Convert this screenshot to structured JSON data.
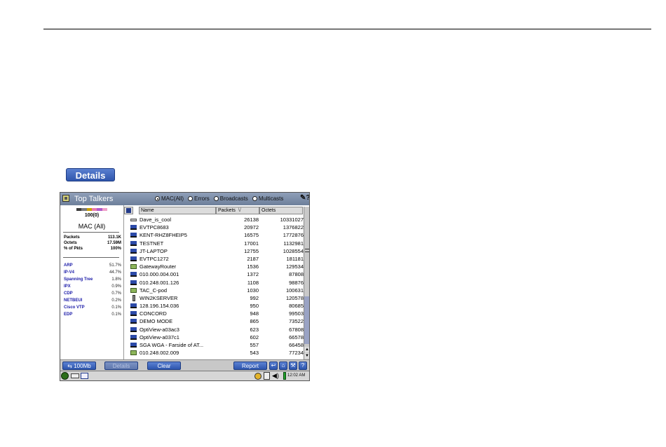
{
  "callout": {
    "details_label": "Details"
  },
  "window": {
    "title": "Top Talkers",
    "radio_options": [
      {
        "label": "MAC(All)",
        "selected": true
      },
      {
        "label": "Errors",
        "selected": false
      },
      {
        "label": "Broadcasts",
        "selected": false
      },
      {
        "label": "Multicasts",
        "selected": false
      }
    ],
    "help_icon": "help-question-icon"
  },
  "summary": {
    "counter": "100(0)",
    "mac_label": "MAC (All)",
    "stats": [
      {
        "label": "Packets",
        "value": "113.1K"
      },
      {
        "label": "Octets",
        "value": "17.59M"
      },
      {
        "label": "% of Pkts",
        "value": "100%"
      }
    ],
    "protocols": [
      {
        "name": "ARP",
        "value": "51.7%"
      },
      {
        "name": "IP-V4",
        "value": "44.7%"
      },
      {
        "name": "Spanning Tree",
        "value": "1.8%"
      },
      {
        "name": "IPX",
        "value": "0.9%"
      },
      {
        "name": "CDP",
        "value": "0.7%"
      },
      {
        "name": "NETBEUI",
        "value": "0.2%"
      },
      {
        "name": "Cisco VTP",
        "value": "0.1%"
      },
      {
        "name": "EDP",
        "value": "0.1%"
      }
    ],
    "strip_colors": [
      "#3a3a3a",
      "#7a7a7a",
      "#c9a000",
      "#e87ab0",
      "#b05ac8",
      "#f0a0c8"
    ]
  },
  "table": {
    "columns": {
      "name": "Name",
      "packets": "Packets",
      "octets": "Octets",
      "sort_mark": "\\/"
    },
    "rows": [
      {
        "icon": "host",
        "name": "Dave_is_cool",
        "packets": "26138",
        "octets": "10331027"
      },
      {
        "icon": "pc",
        "name": "EVTPC8683",
        "packets": "20972",
        "octets": "1376822"
      },
      {
        "icon": "pc",
        "name": "KENT-RHZ8FHEIP5",
        "packets": "16575",
        "octets": "1772876"
      },
      {
        "icon": "pc",
        "name": "TESTNET",
        "packets": "17001",
        "octets": "1132981"
      },
      {
        "icon": "pc",
        "name": "JT-LAPTOP",
        "packets": "12755",
        "octets": "1028554"
      },
      {
        "icon": "pc",
        "name": "EVTPC1272",
        "packets": "2187",
        "octets": "181181"
      },
      {
        "icon": "router",
        "name": "GatewayRouter",
        "packets": "1536",
        "octets": "129534"
      },
      {
        "icon": "pc",
        "name": "010.000.004.001",
        "packets": "1372",
        "octets": "87808"
      },
      {
        "icon": "pc",
        "name": "010.248.001.126",
        "packets": "1108",
        "octets": "98876"
      },
      {
        "icon": "router",
        "name": "TAC_C-pod",
        "packets": "1030",
        "octets": "100631"
      },
      {
        "icon": "server",
        "name": "WIN2KSERVER",
        "packets": "992",
        "octets": "120578"
      },
      {
        "icon": "pc",
        "name": "128.196.154.036",
        "packets": "950",
        "octets": "80685"
      },
      {
        "icon": "pc",
        "name": "CONCORD",
        "packets": "948",
        "octets": "99503"
      },
      {
        "icon": "pc",
        "name": "DEMO MODE",
        "packets": "865",
        "octets": "73522"
      },
      {
        "icon": "pc",
        "name": "OptiView-a03ac3",
        "packets": "623",
        "octets": "67808"
      },
      {
        "icon": "pc",
        "name": "OptiView-a037c1",
        "packets": "602",
        "octets": "66578"
      },
      {
        "icon": "pc",
        "name": "SGA WGA - Farside of AT...",
        "packets": "557",
        "octets": "66458"
      },
      {
        "icon": "router",
        "name": "010.248.002.009",
        "packets": "543",
        "octets": "77234"
      }
    ]
  },
  "buttons": {
    "speed": "100Mb",
    "details": "Details",
    "clear": "Clear",
    "report": "Report",
    "icon_buttons": [
      "back-icon",
      "home-icon",
      "tools-icon",
      "help-icon"
    ]
  },
  "taskbar": {
    "clock": "12:02 AM"
  }
}
